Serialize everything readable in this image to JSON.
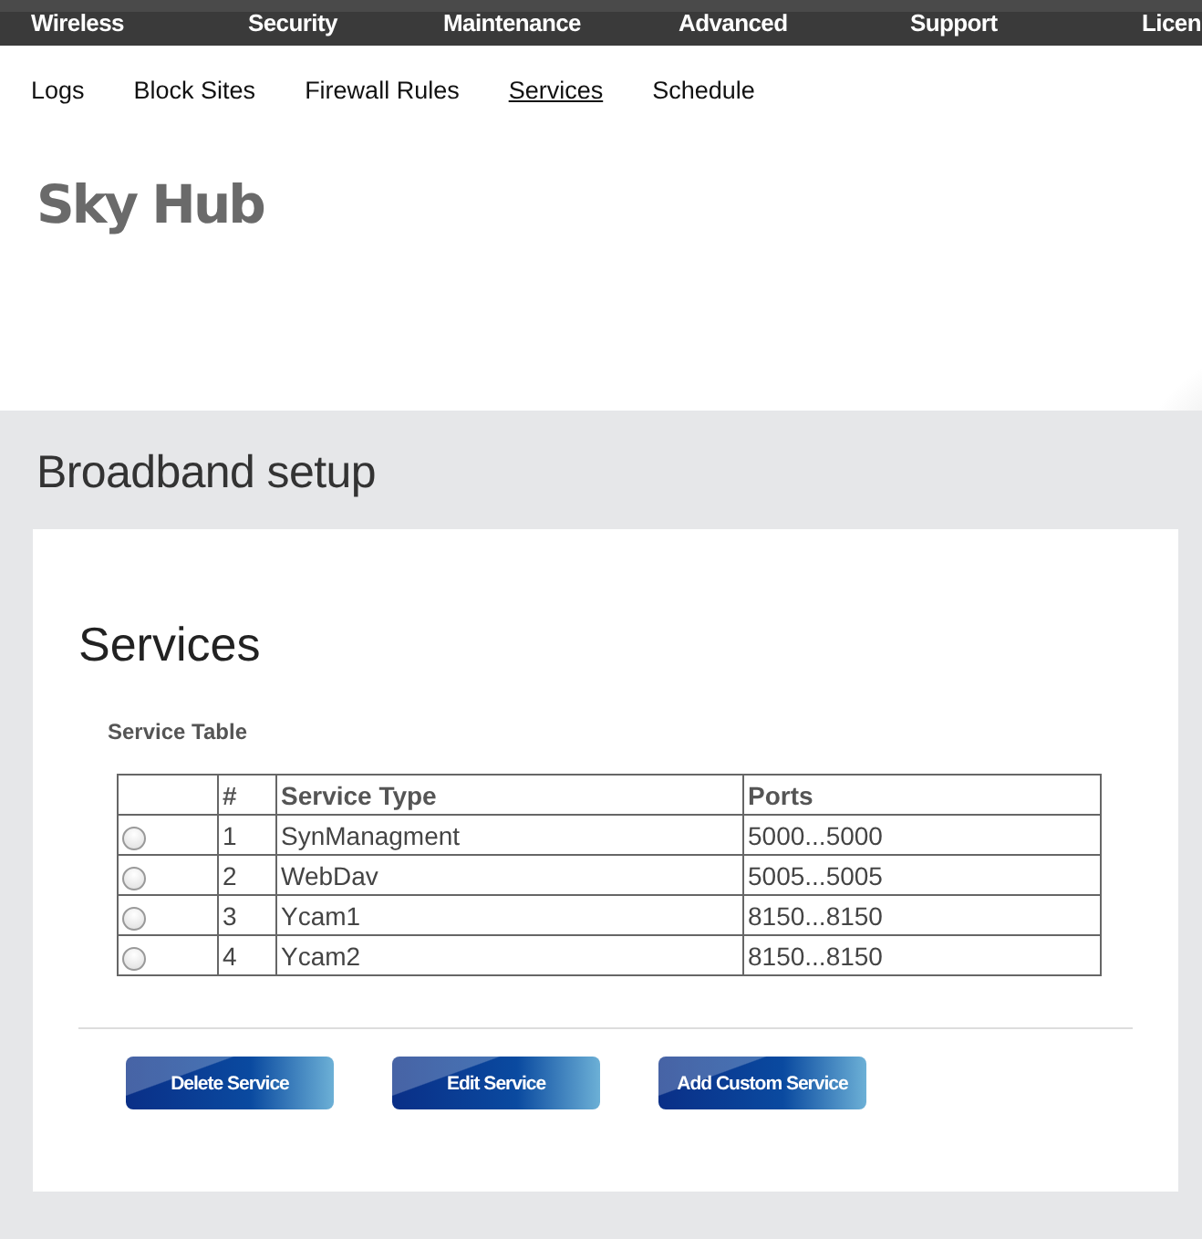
{
  "top_nav": [
    {
      "label": "Wireless"
    },
    {
      "label": "Security"
    },
    {
      "label": "Maintenance"
    },
    {
      "label": "Advanced"
    },
    {
      "label": "Support"
    },
    {
      "label": "Licen"
    }
  ],
  "sub_nav": [
    {
      "label": "Logs",
      "selected": false
    },
    {
      "label": "Block Sites",
      "selected": false
    },
    {
      "label": "Firewall Rules",
      "selected": false
    },
    {
      "label": "Services",
      "selected": true
    },
    {
      "label": "Schedule",
      "selected": false
    }
  ],
  "brand": "Sky Hub",
  "page_title": "Broadband setup",
  "section_title": "Services",
  "table_caption": "Service Table",
  "table": {
    "columns": [
      "",
      "#",
      "Service Type",
      "Ports"
    ],
    "rows": [
      {
        "selected": false,
        "number": "1",
        "service_type": "SynManagment",
        "ports": "5000...5000"
      },
      {
        "selected": false,
        "number": "2",
        "service_type": "WebDav",
        "ports": "5005...5005"
      },
      {
        "selected": false,
        "number": "3",
        "service_type": "Ycam1",
        "ports": "8150...8150"
      },
      {
        "selected": false,
        "number": "4",
        "service_type": "Ycam2",
        "ports": "8150...8150"
      }
    ]
  },
  "buttons": [
    "Delete Service",
    "Edit Service",
    "Add Custom Service"
  ]
}
